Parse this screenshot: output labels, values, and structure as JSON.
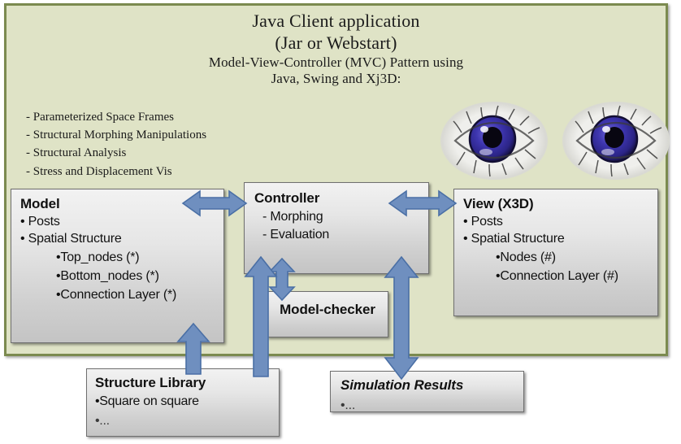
{
  "diagram": {
    "title_lines": [
      "Java Client application",
      "(Jar or Webstart)",
      "Model-View-Controller (MVC) Pattern using",
      "Java, Swing and Xj3D:"
    ],
    "features": [
      "- Parameterized Space Frames",
      "- Structural Morphing Manipulations",
      "- Structural Analysis",
      "- Stress and Displacement Vis"
    ],
    "colors": {
      "panel_background": "#dfe3c6",
      "panel_border": "#7b8a4f",
      "box_fill_top": "#f2f2f2",
      "box_fill_bottom": "#c4c4c4",
      "box_border": "#6f6f6f",
      "arrow_fill": "#6f8fbf",
      "arrow_stroke": "#4a6fa5",
      "iris": "#3a33a8",
      "page_background": "#ffffff"
    },
    "boxes": {
      "model": {
        "title": "Model",
        "lines": [
          "• Posts",
          "• Spatial Structure"
        ],
        "sublines": [
          "•Top_nodes (*)",
          "•Bottom_nodes (*)",
          "•Connection Layer (*)"
        ]
      },
      "controller": {
        "title": "Controller",
        "lines": [
          "- Morphing",
          "- Evaluation"
        ]
      },
      "view": {
        "title": "View (X3D)",
        "lines": [
          "• Posts",
          "• Spatial Structure"
        ],
        "sublines": [
          "•Nodes (#)",
          "•Connection Layer (#)"
        ]
      },
      "model_checker": {
        "title": "Model-checker"
      },
      "structure_library": {
        "title": "Structure Library",
        "lines": [
          "•Square on square",
          "•..."
        ]
      },
      "simulation_results": {
        "title": "Simulation Results",
        "lines": [
          "•..."
        ]
      }
    },
    "arrows": [
      {
        "name": "model-controller",
        "kind": "double-horizontal"
      },
      {
        "name": "controller-view",
        "kind": "double-horizontal"
      },
      {
        "name": "controller-modelchecker",
        "kind": "double-vertical"
      },
      {
        "name": "structurelibrary-model",
        "kind": "up"
      },
      {
        "name": "structurelibrary-controller",
        "kind": "up"
      },
      {
        "name": "controller-simulationresults",
        "kind": "double-vertical-long"
      }
    ],
    "images": {
      "eyes_left": "eye-image",
      "eyes_right": "eye-image"
    }
  }
}
